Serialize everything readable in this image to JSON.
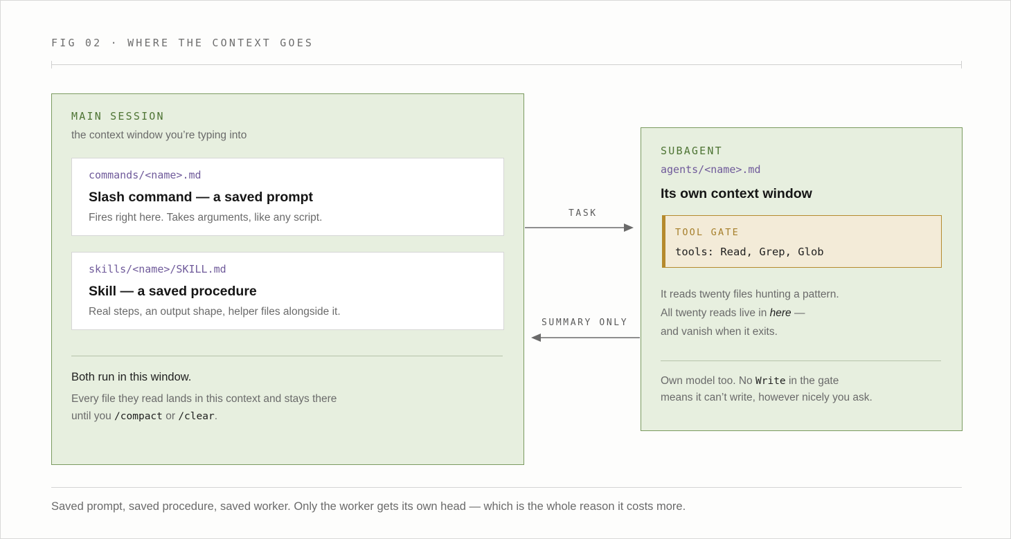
{
  "figure": {
    "title": "FIG 02 · WHERE THE CONTEXT GOES"
  },
  "main_session": {
    "label": "MAIN SESSION",
    "subtitle": "the context window you’re typing into",
    "cards": [
      {
        "path": "commands/<name>.md",
        "title": "Slash command — a saved prompt",
        "description": "Fires right here. Takes arguments, like any script."
      },
      {
        "path": "skills/<name>/SKILL.md",
        "title": "Skill — a saved procedure",
        "description": "Real steps, an output shape, helper files alongside it."
      }
    ],
    "footer_heading": "Both run in this window.",
    "footer_line1": "Every file they read lands in this context and stays there",
    "footer_until": "until you",
    "footer_cmd1": "/compact",
    "footer_or": "or",
    "footer_cmd2": "/clear",
    "footer_end": "."
  },
  "arrows": {
    "task_label": "TASK",
    "summary_label": "SUMMARY ONLY"
  },
  "subagent": {
    "label": "SUBAGENT",
    "path": "agents/<name>.md",
    "title": "Its own context window",
    "gate_label": "TOOL GATE",
    "gate_tools": "tools: Read, Grep, Glob",
    "desc_line1": "It reads twenty files hunting a pattern.",
    "desc_line2_pre": "All twenty reads live in",
    "desc_line2_em": "here",
    "desc_line2_post": "—",
    "desc_line3": "and vanish when it exits.",
    "note_pre": "Own model too. No",
    "note_code": "Write",
    "note_post": "in the gate",
    "note_line2": "means it can’t write, however nicely you ask."
  },
  "caption": "Saved prompt, saved procedure, saved worker. Only the worker gets its own head — which is the whole reason it costs more."
}
